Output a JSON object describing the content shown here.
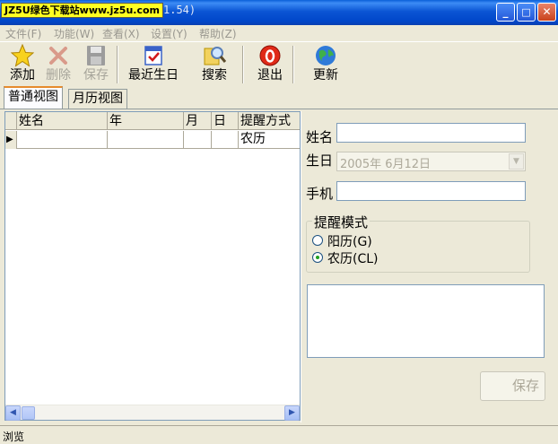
{
  "window": {
    "watermark": "JZ5U绿色下载站www.jz5u.com",
    "title_suffix": "1.54)",
    "controls": {
      "minimize": "_",
      "maximize": "□",
      "close": "✕"
    }
  },
  "menu": [
    "文件(F)",
    "功能(W)",
    "查看(X)",
    "设置(Y)",
    "帮助(Z)"
  ],
  "toolbar": {
    "add": "添加",
    "delete": "删除",
    "save": "保存",
    "recent": "最近生日",
    "search": "搜索",
    "exit": "退出",
    "update": "更新"
  },
  "tabs": [
    "普通视图",
    "月历视图"
  ],
  "grid": {
    "columns": [
      "姓名",
      "年",
      "月",
      "日",
      "提醒方式"
    ],
    "rows": [
      {
        "indicator": "▶",
        "name": "",
        "year": "",
        "month": "",
        "day": "",
        "mode": "农历"
      }
    ]
  },
  "form": {
    "name_label": "姓名",
    "name_value": "",
    "birthday_label": "生日",
    "birthday_value": "2005年  6月12日",
    "phone_label": "手机",
    "phone_value": "",
    "reminder_group": "提醒模式",
    "reminder_options": [
      "阳历(G)",
      "农历(CL)"
    ],
    "reminder_selected": "农历(CL)",
    "save": "保存"
  },
  "status": "浏览",
  "colors": {
    "titlebar": "#0b55d4",
    "watermark_bg": "#ffff22",
    "window_bg": "#ece9d8",
    "tab_accent": "#e68b2c",
    "disabled_text": "#aca899"
  }
}
